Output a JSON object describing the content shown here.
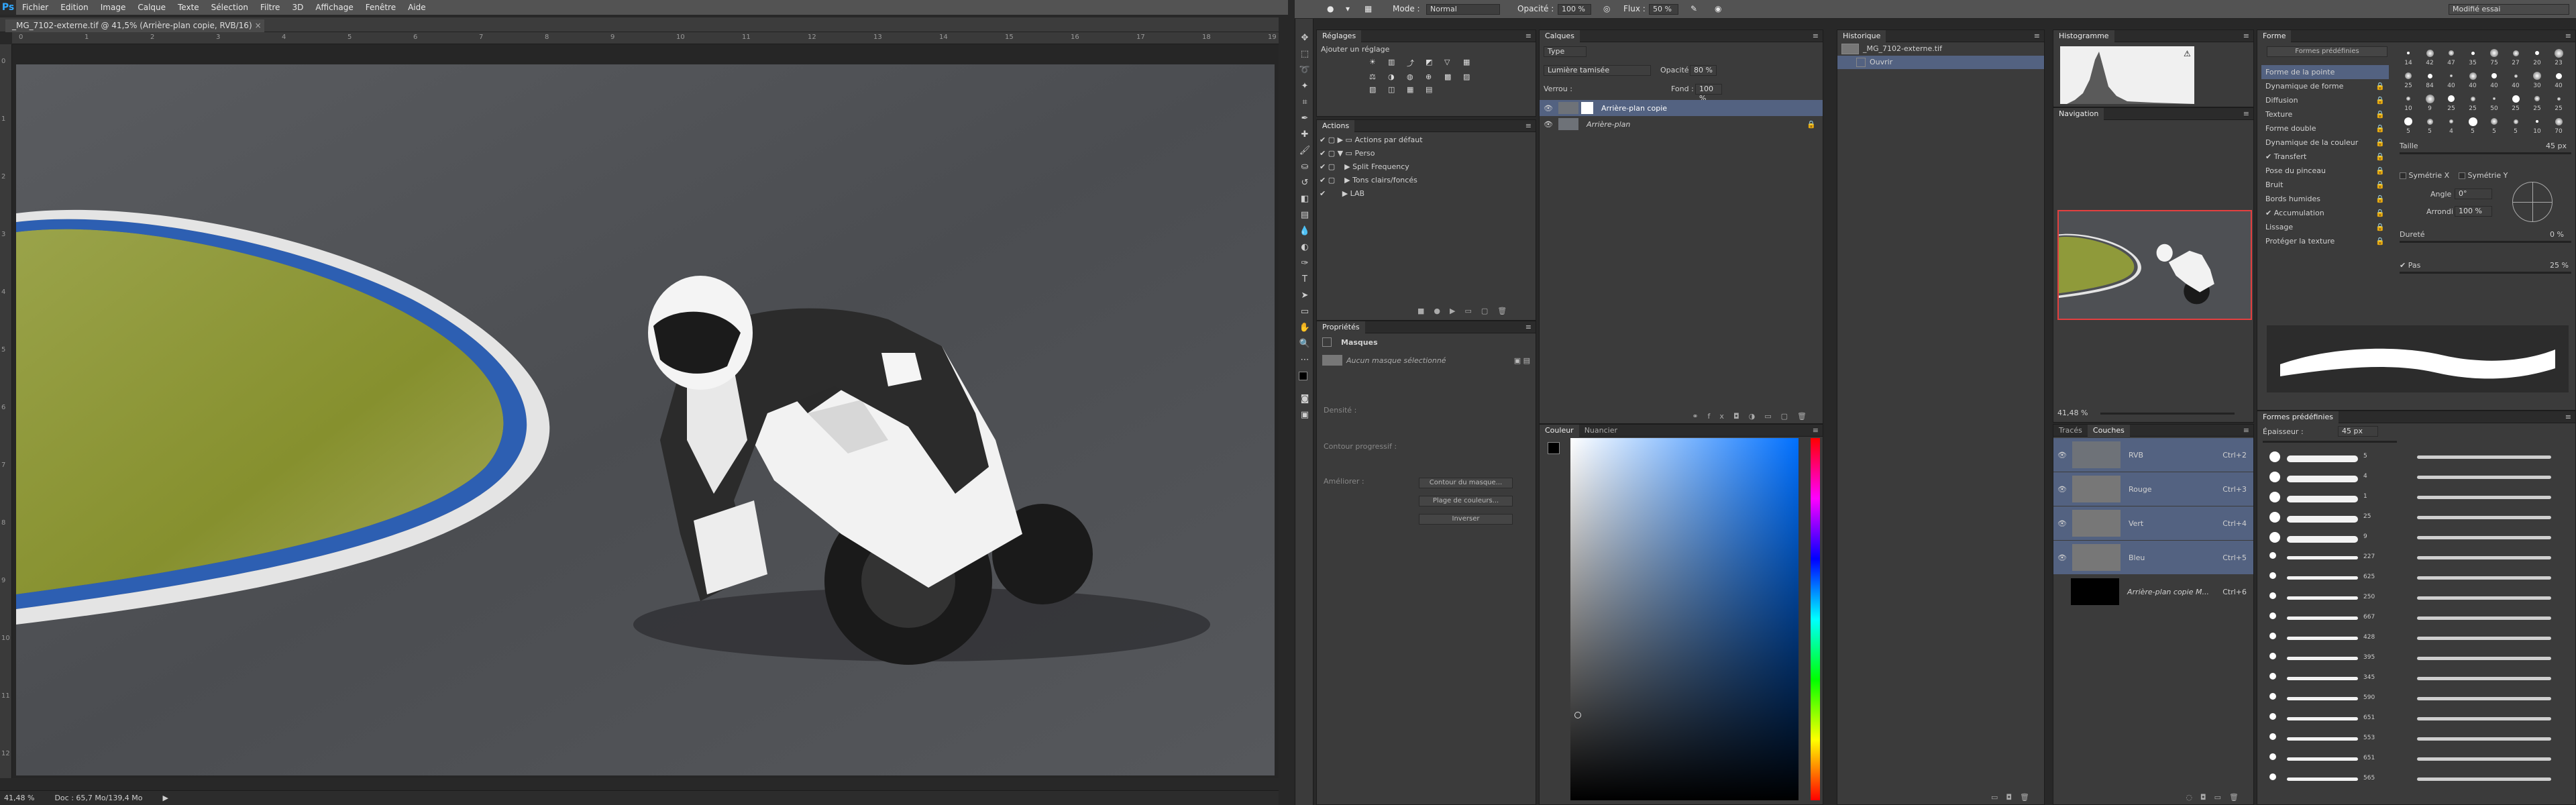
{
  "app": {
    "logo": "Ps",
    "menu": [
      "Fichier",
      "Edition",
      "Image",
      "Calque",
      "Texte",
      "Sélection",
      "Filtre",
      "3D",
      "Affichage",
      "Fenêtre",
      "Aide"
    ]
  },
  "document": {
    "tab_title": "_MG_7102-externe.tif @ 41,5% (Arrière-plan copie, RVB/16)",
    "close": "×",
    "ruler_h": [
      "0",
      "1",
      "2",
      "3",
      "4",
      "5",
      "6",
      "7",
      "8",
      "9",
      "10",
      "11",
      "12",
      "13",
      "14",
      "15",
      "16",
      "17",
      "18",
      "19"
    ],
    "ruler_v": [
      "0",
      "1",
      "2",
      "3",
      "4",
      "5",
      "6",
      "7",
      "8",
      "9",
      "10",
      "11",
      "12"
    ]
  },
  "status": {
    "zoom": "41,48 %",
    "doc": "Doc : 65,7 Mo/139,4 Mo",
    "arrow": "▶"
  },
  "options": {
    "mode_label": "Mode :",
    "mode_value": "Normal",
    "opacity_label": "Opacité :",
    "opacity_value": "100 %",
    "flux_label": "Flux :",
    "flux_value": "50 %",
    "workspace": "Modifié essai"
  },
  "reglages": {
    "tab": "Réglages",
    "title": "Ajouter un réglage"
  },
  "actions": {
    "tab": "Actions",
    "items": [
      "Actions par défaut",
      "Perso",
      "Split Frequency",
      "Tons clairs/foncés",
      "LAB"
    ]
  },
  "proprietes": {
    "tab": "Propriétés",
    "section": "Masques",
    "no_mask": "Aucun masque sélectionné",
    "densite": "Densité :",
    "contour": "Contour progressif :",
    "ameliorer": "Améliorer :",
    "btn1": "Contour du masque...",
    "btn2": "Plage de couleurs...",
    "btn3": "Inverser"
  },
  "calques": {
    "tab": "Calques",
    "filter": "Type",
    "blend": "Lumière tamisée",
    "opacity_label": "Opacité :",
    "opacity_value": "80 %",
    "lock_label": "Verrou :",
    "fill_label": "Fond :",
    "fill_value": "100 %",
    "layers": [
      {
        "name": "Arrière-plan copie"
      },
      {
        "name": "Arrière-plan"
      }
    ]
  },
  "couleur": {
    "tabs": [
      "Couleur",
      "Nuancier"
    ]
  },
  "historique": {
    "tab": "Historique",
    "file": "_MG_7102-externe.tif",
    "step": "Ouvrir"
  },
  "histogramme": {
    "tab": "Histogramme"
  },
  "navigation": {
    "tab": "Navigation",
    "zoom": "41,48 %"
  },
  "couches": {
    "tabs": [
      "Tracés",
      "Couches"
    ],
    "rows": [
      {
        "name": "RVB",
        "key": "Ctrl+2"
      },
      {
        "name": "Rouge",
        "key": "Ctrl+3"
      },
      {
        "name": "Vert",
        "key": "Ctrl+4"
      },
      {
        "name": "Bleu",
        "key": "Ctrl+5"
      },
      {
        "name": "Arrière-plan copie M...",
        "key": "Ctrl+6"
      }
    ]
  },
  "forme": {
    "tab": "Forme",
    "btn": "Formes prédéfinies",
    "items": [
      "Forme de la pointe",
      "Dynamique de forme",
      "Diffusion",
      "Texture",
      "Forme double",
      "Dynamique de la couleur",
      "Transfert",
      "Pose du pinceau",
      "Bruit",
      "Bords humides",
      "Accumulation",
      "Lissage",
      "Protéger la texture"
    ],
    "checked": [
      false,
      false,
      false,
      false,
      false,
      false,
      true,
      false,
      false,
      false,
      true,
      false,
      false
    ],
    "taille_label": "Taille",
    "taille_value": "45 px",
    "symx": "Symétrie X",
    "symy": "Symétrie Y",
    "angle_label": "Angle :",
    "angle_value": "0°",
    "arrondi_label": "Arrondi :",
    "arrondi_value": "100 %",
    "durete_label": "Dureté",
    "durete_value": "0 %",
    "pas_label": "Pas",
    "pas_value": "25 %",
    "sizes": [
      "14",
      "42",
      "47",
      "35",
      "75",
      "27",
      "20",
      "23",
      "25",
      "84",
      "40",
      "40",
      "40",
      "40",
      "30",
      "40",
      "10",
      "9",
      "25",
      "25",
      "50",
      "25",
      "25",
      "25",
      "5",
      "5",
      "4",
      "5",
      "5",
      "5",
      "10",
      "70"
    ]
  },
  "formes_predef": {
    "tab": "Formes prédéfinies",
    "epaisseur_label": "Épaisseur :",
    "epaisseur_value": "45 px",
    "sizes": [
      "5",
      "4",
      "1",
      "25",
      "9",
      "227",
      "625",
      "250",
      "667",
      "428",
      "395",
      "345",
      "590",
      "651",
      "553",
      "651",
      "565"
    ]
  }
}
